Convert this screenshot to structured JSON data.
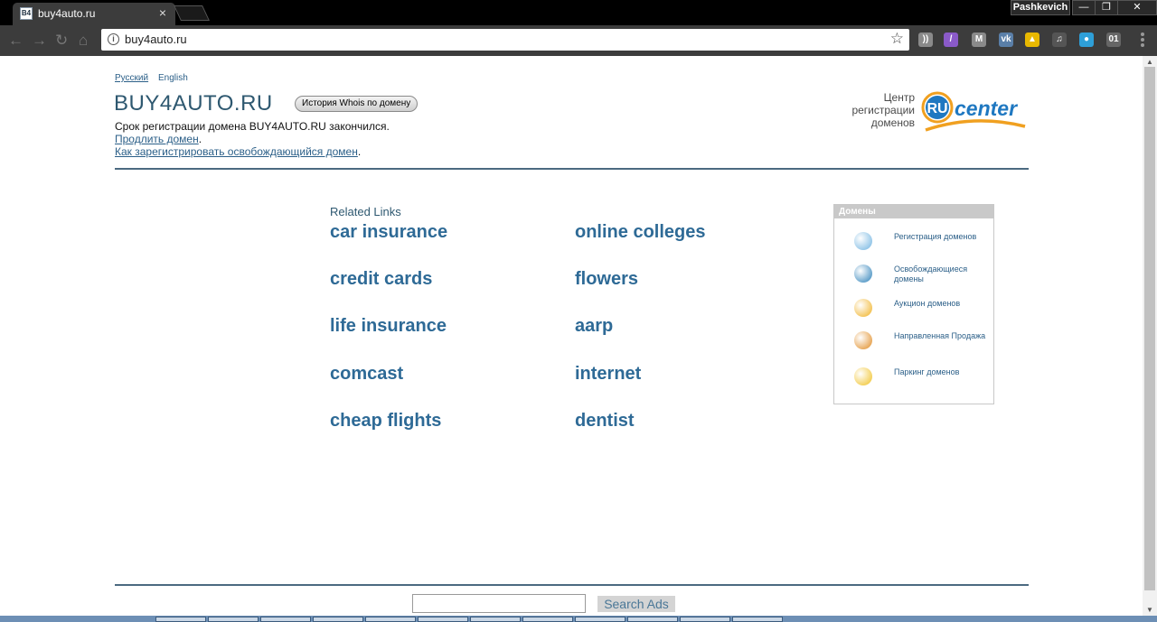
{
  "browser": {
    "tab_title": "buy4auto.ru",
    "tab_close": "×",
    "profile_name": "Pashkevich",
    "url": "buy4auto.ru",
    "window_controls": [
      "—",
      "❐",
      "✕"
    ],
    "extensions": [
      {
        "name": "rss-icon",
        "color": "#8a8a8a",
        "glyph": "))"
      },
      {
        "name": "feather-icon",
        "color": "#8a5ac8",
        "glyph": "/"
      },
      {
        "name": "gmail-icon",
        "color": "#8a8a8a",
        "glyph": "M"
      },
      {
        "name": "vk-icon",
        "color": "#5a7fa8",
        "glyph": "vk"
      },
      {
        "name": "drive-icon",
        "color": "#e8b800",
        "glyph": "▲"
      },
      {
        "name": "music-icon",
        "color": "#555555",
        "glyph": "♫"
      },
      {
        "name": "chrome-icon",
        "color": "#2e9fd8",
        "glyph": "●"
      },
      {
        "name": "counter-icon",
        "color": "#666666",
        "glyph": "01"
      }
    ]
  },
  "page": {
    "lang_ru": "Русский",
    "lang_en": "English",
    "domain_title": "BUY4AUTO.RU",
    "whois_button": "История Whois по домену",
    "expired_text": "Срок регистрации домена BUY4AUTO.RU закончился.",
    "renew_link": "Продлить домен",
    "howto_link": "Как зарегистрировать освобождающийся домен",
    "punct": ".",
    "rucenter_text": "Центр регистрации доменов",
    "rucenter_ru": "RU",
    "rucenter_center": "center",
    "related_title": "Related Links",
    "related_left": [
      "car insurance",
      "credit cards",
      "life insurance",
      "comcast",
      "cheap flights"
    ],
    "related_right": [
      "online colleges",
      "flowers",
      "aarp",
      "internet",
      "dentist"
    ],
    "domains_header": "Домены",
    "domains_items": [
      {
        "label": "Регистрация доменов",
        "icon": "globe-icon",
        "color": "#6fb3e0"
      },
      {
        "label": "Освобождающиеся домены",
        "icon": "ru-wings-icon",
        "color": "#2a7fb8"
      },
      {
        "label": "Аукцион доменов",
        "icon": "coins-icon",
        "color": "#f0b020"
      },
      {
        "label": "Направленная Продажа",
        "icon": "exchange-icon",
        "color": "#e08a20"
      },
      {
        "label": "Паркинг доменов",
        "icon": "coin-stack-icon",
        "color": "#f0c020"
      }
    ],
    "search_button": "Search Ads",
    "search_value": ""
  }
}
